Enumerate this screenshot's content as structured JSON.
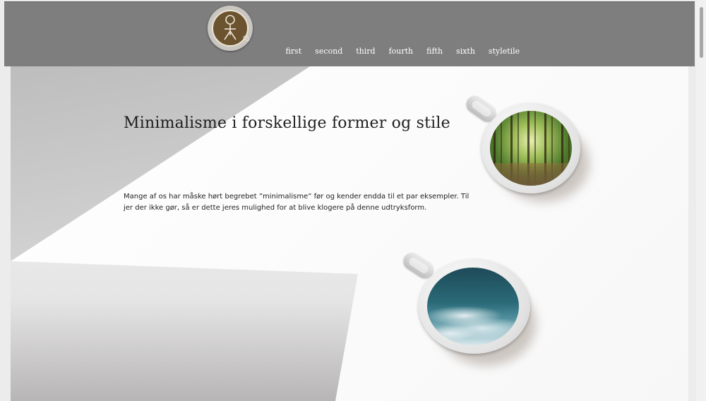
{
  "header": {
    "logo": {
      "icon": "fish-symbol-coffee-cup-icon",
      "colors": {
        "cup": "#6b5330",
        "line": "#ebe3d3"
      }
    },
    "nav": [
      {
        "label": "first"
      },
      {
        "label": "second"
      },
      {
        "label": "third"
      },
      {
        "label": "fourth"
      },
      {
        "label": "fifth"
      },
      {
        "label": "sixth"
      },
      {
        "label": "styletile"
      }
    ]
  },
  "main": {
    "title": "Minimalisme i forskellige former og stile",
    "intro": "Mange af os har måske hørt begrebet ”minimalisme” før og kender endda til et par eksempler. Til jer der ikke gør, så er dette jeres mulighed for at blive klogere på denne udtryksform.",
    "images": [
      {
        "name": "forest-in-coffee-cup",
        "icon": "forest-cup-image"
      },
      {
        "name": "ocean-in-coffee-cup",
        "icon": "ocean-cup-image"
      }
    ]
  },
  "colors": {
    "header_bg": "#7e7e7e",
    "nav_text": "#ffffff",
    "title_text": "#1e1e1e"
  }
}
